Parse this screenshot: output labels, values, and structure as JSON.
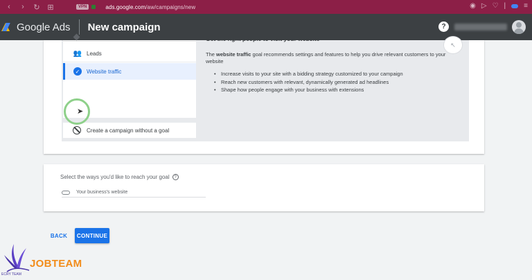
{
  "browser": {
    "vpn_badge": "VPN",
    "url_domain": "ads.google.com",
    "url_path": "/aw/campaigns/new"
  },
  "header": {
    "brand": "Google Ads",
    "page_title": "New campaign",
    "help_icon_glyph": "?"
  },
  "goals": {
    "items": [
      {
        "label": "Leads",
        "icon": "people-icon",
        "selected": false
      },
      {
        "label": "Website traffic",
        "icon": "check-circle-icon",
        "selected": true
      }
    ],
    "no_goal_label": "Create a campaign without a goal"
  },
  "goal_description": {
    "heading": "Get the right people to visit your website",
    "intro_prefix": "The ",
    "intro_bold": "website traffic",
    "intro_suffix": " goal recommends settings and features to help you drive relevant customers to your website",
    "bullets": [
      "Increase visits to your site with a bidding strategy customized to your campaign",
      "Reach new customers with relevant, dynamically generated ad headlines",
      "Shape how people engage with your business with extensions"
    ]
  },
  "reach": {
    "label": "Select the ways you'd like to reach your goal",
    "help_glyph": "?",
    "option_label": "Your business's website"
  },
  "actions": {
    "back_label": "BACK",
    "continue_label": "CONTINUE"
  },
  "watermark": {
    "name": "JOBTEAM",
    "small_text": "ECRY TEAM"
  },
  "colors": {
    "browser_bar": "#8c1f47",
    "header_bg": "#3c4043",
    "accent": "#1a73e8",
    "watermark_orange": "#f28c1a"
  }
}
